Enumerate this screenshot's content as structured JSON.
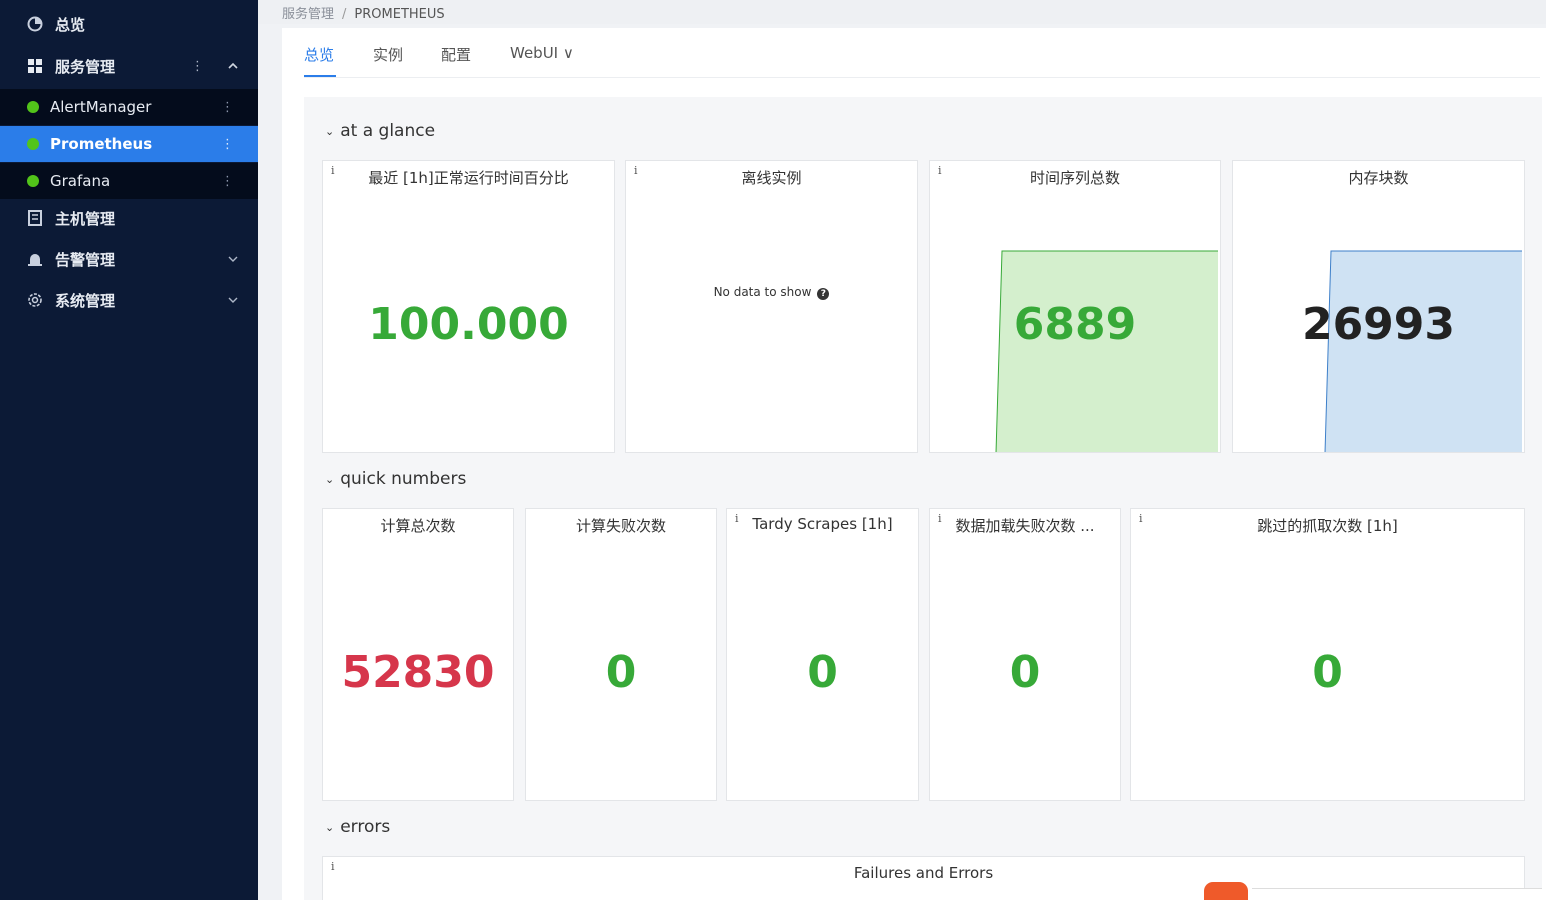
{
  "sidebar": {
    "overview": "总览",
    "service_mgmt": "服务管理",
    "services": [
      "AlertManager",
      "Prometheus",
      "Grafana"
    ],
    "host_mgmt": "主机管理",
    "alert_mgmt": "告警管理",
    "system_mgmt": "系统管理",
    "kebab": "⋮",
    "active_service": "Prometheus"
  },
  "breadcrumb": {
    "parent": "服务管理",
    "sep": "/",
    "current": "PROMETHEUS"
  },
  "tabs": [
    {
      "label": "总览",
      "active": true
    },
    {
      "label": "实例"
    },
    {
      "label": "配置"
    },
    {
      "label": "WebUI ∨"
    }
  ],
  "rows": {
    "glance": "at a glance",
    "quick": "quick numbers",
    "errors": "errors"
  },
  "glance_panels": [
    {
      "title": "最近 [1h]正常运行时间百分比",
      "value": "100.000",
      "info": "i"
    },
    {
      "title": "离线实例",
      "nodata": "No data to show",
      "info": "i"
    },
    {
      "title": "时间序列总数",
      "value": "6889",
      "info": "i"
    },
    {
      "title": "内存块数",
      "value": "26993"
    }
  ],
  "quick_panels": [
    {
      "title": "计算总次数",
      "value": "52830"
    },
    {
      "title": "计算失败次数",
      "value": "0"
    },
    {
      "title": "Tardy Scrapes [1h]",
      "value": "0",
      "info": "i"
    },
    {
      "title": "数据加载失败次数 ...",
      "value": "0",
      "info": "i"
    },
    {
      "title": "跳过的抓取次数 [1h]",
      "value": "0",
      "info": "i"
    }
  ],
  "errors_panel": {
    "title": "Failures and Errors",
    "info": "i"
  },
  "colors": {
    "sidebar_bg": "#0c1a36",
    "active_blue": "#2b7de9",
    "ok_green": "#37a938",
    "warn_red": "#d6364b",
    "status_dot": "#52c41a",
    "spark_green_fill": "#d4efcd",
    "spark_blue_fill": "#cfe2f3"
  }
}
